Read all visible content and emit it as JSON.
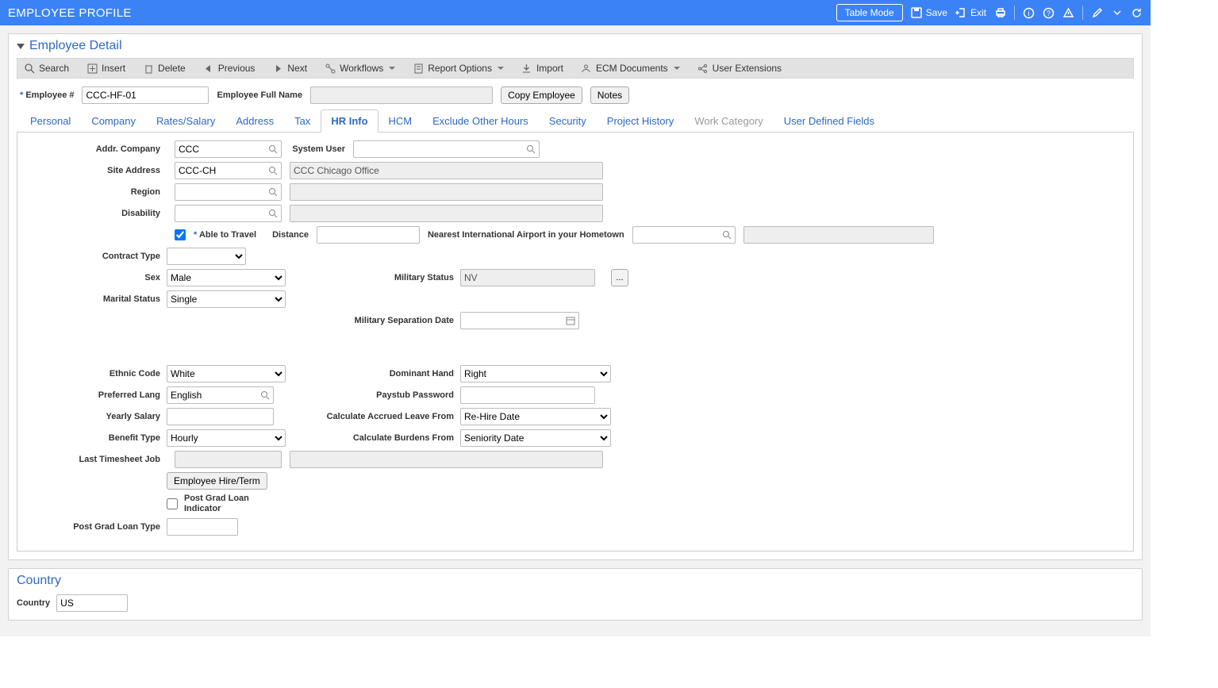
{
  "header": {
    "title": "EMPLOYEE PROFILE",
    "table_mode_btn": "Table Mode",
    "save_btn": "Save",
    "exit_btn": "Exit"
  },
  "panel": {
    "title": "Employee Detail"
  },
  "toolbar": {
    "search": "Search",
    "insert": "Insert",
    "delete": "Delete",
    "previous": "Previous",
    "next": "Next",
    "workflows": "Workflows",
    "report_options": "Report Options",
    "import": "Import",
    "ecm_documents": "ECM Documents",
    "user_extensions": "User Extensions"
  },
  "key": {
    "employee_num_lbl": "Employee #",
    "employee_num_val": "CCC-HF-01",
    "employee_full_name_lbl": "Employee Full Name",
    "employee_full_name_val": "",
    "copy_employee_btn": "Copy Employee",
    "notes_btn": "Notes"
  },
  "tabs": {
    "personal": "Personal",
    "company": "Company",
    "rates_salary": "Rates/Salary",
    "address": "Address",
    "tax": "Tax",
    "hr_info": "HR Info",
    "hcm": "HCM",
    "exclude_other_hours": "Exclude Other Hours",
    "security": "Security",
    "project_history": "Project History",
    "work_category": "Work Category",
    "user_defined_fields": "User Defined Fields"
  },
  "hr": {
    "addr_company_lbl": "Addr. Company",
    "addr_company_val": "CCC",
    "system_user_lbl": "System User",
    "system_user_val": "",
    "site_address_lbl": "Site Address",
    "site_address_val": "CCC-CH",
    "site_address_name": "CCC Chicago Office",
    "region_lbl": "Region",
    "region_val": "",
    "disability_lbl": "Disability",
    "disability_val": "",
    "able_to_travel_lbl": "Able to Travel",
    "able_to_travel_checked": true,
    "distance_lbl": "Distance",
    "distance_val": "",
    "nearest_airport_lbl": "Nearest International Airport in your Hometown",
    "nearest_airport_val": "",
    "contract_type_lbl": "Contract Type",
    "contract_type_val": "",
    "sex_lbl": "Sex",
    "sex_val": "Male",
    "military_status_lbl": "Military Status",
    "military_status_val": "NV",
    "marital_status_lbl": "Marital Status",
    "marital_status_val": "Single",
    "military_sep_date_lbl": "Military Separation Date",
    "military_sep_date_val": "",
    "ethnic_code_lbl": "Ethnic Code",
    "ethnic_code_val": "White",
    "dominant_hand_lbl": "Dominant Hand",
    "dominant_hand_val": "Right",
    "preferred_lang_lbl": "Preferred Lang",
    "preferred_lang_val": "English",
    "paystub_password_lbl": "Paystub Password",
    "paystub_password_val": "",
    "yearly_salary_lbl": "Yearly Salary",
    "yearly_salary_val": "",
    "calc_accrued_leave_lbl": "Calculate Accrued Leave From",
    "calc_accrued_leave_val": "Re-Hire Date",
    "benefit_type_lbl": "Benefit Type",
    "benefit_type_val": "Hourly",
    "calc_burdens_lbl": "Calculate Burdens From",
    "calc_burdens_val": "Seniority Date",
    "last_timesheet_job_lbl": "Last Timesheet Job",
    "last_timesheet_job_val": "",
    "employee_hire_term_btn": "Employee Hire/Term",
    "post_grad_loan_ind_lbl": "Post Grad Loan Indicator",
    "post_grad_loan_type_lbl": "Post Grad Loan Type",
    "post_grad_loan_type_val": ""
  },
  "country": {
    "panel_title": "Country",
    "country_lbl": "Country",
    "country_val": "US"
  }
}
